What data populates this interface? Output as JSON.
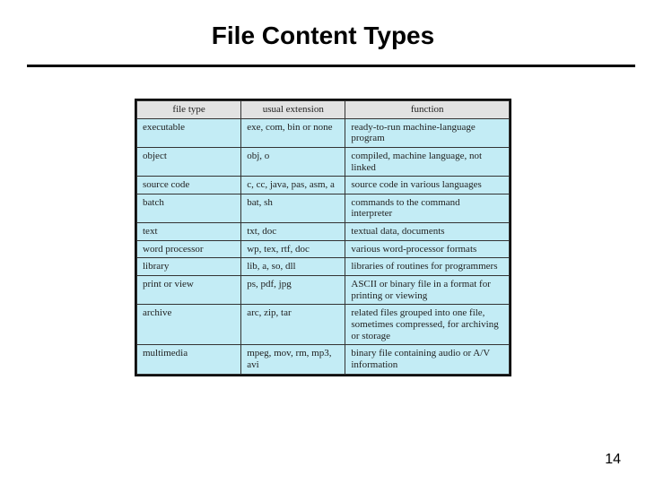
{
  "slide": {
    "title": "File Content Types",
    "page_number": "14",
    "table": {
      "headers": [
        "file type",
        "usual extension",
        "function"
      ],
      "rows": [
        {
          "type": "executable",
          "ext": "exe, com, bin or none",
          "func": "ready-to-run machine-language program"
        },
        {
          "type": "object",
          "ext": "obj, o",
          "func": "compiled, machine language, not linked"
        },
        {
          "type": "source code",
          "ext": "c, cc, java, pas, asm, a",
          "func": "source code in various languages"
        },
        {
          "type": "batch",
          "ext": "bat, sh",
          "func": "commands to the command interpreter"
        },
        {
          "type": "text",
          "ext": "txt, doc",
          "func": "textual data, documents"
        },
        {
          "type": "word processor",
          "ext": "wp, tex, rtf, doc",
          "func": "various word-processor formats"
        },
        {
          "type": "library",
          "ext": "lib, a, so, dll",
          "func": "libraries of routines for programmers"
        },
        {
          "type": "print or view",
          "ext": "ps, pdf, jpg",
          "func": "ASCII or binary file in a format for printing or viewing"
        },
        {
          "type": "archive",
          "ext": "arc, zip, tar",
          "func": "related files grouped into one file, sometimes compressed, for archiving or storage"
        },
        {
          "type": "multimedia",
          "ext": "mpeg, mov, rm, mp3, avi",
          "func": "binary file containing audio or A/V information"
        }
      ]
    }
  }
}
